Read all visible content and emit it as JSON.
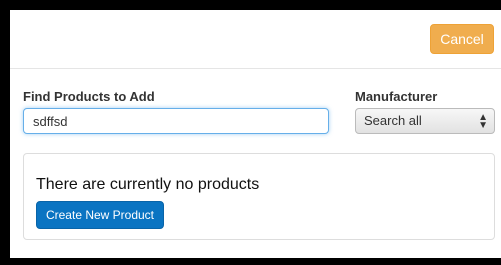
{
  "header": {
    "cancel_label": "Cancel"
  },
  "form": {
    "find_label": "Find Products to Add",
    "search_value": "sdffsd",
    "manufacturer_label": "Manufacturer",
    "manufacturer_selected": "Search all"
  },
  "results": {
    "empty_message": "There are currently no products",
    "create_label": "Create New Product"
  },
  "colors": {
    "cancel": "#f0ad4e",
    "primary": "#0a74c2",
    "focus_border": "#66afe9"
  }
}
